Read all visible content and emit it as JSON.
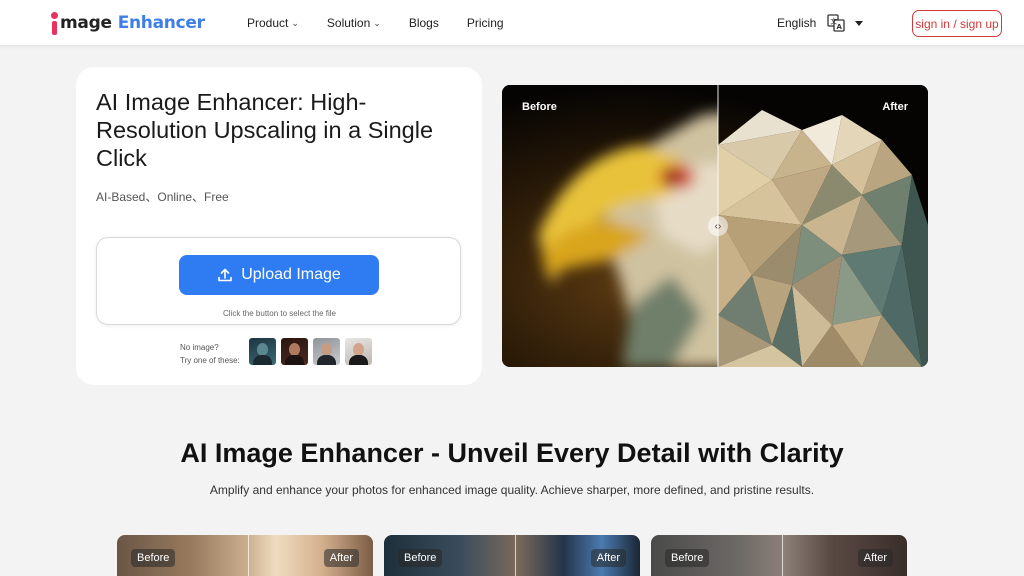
{
  "header": {
    "logo_word": "mage",
    "logo_brand": "Enhancer",
    "nav": [
      {
        "label": "Product",
        "has_dropdown": true
      },
      {
        "label": "Solution",
        "has_dropdown": true
      },
      {
        "label": "Blogs",
        "has_dropdown": false
      },
      {
        "label": "Pricing",
        "has_dropdown": false
      }
    ],
    "language": "English",
    "signin_label": "sign in / sign up"
  },
  "hero": {
    "title": "AI Image Enhancer: High-Resolution Upscaling in a Single Click",
    "subtitle": "AI-Based、Online、Free",
    "upload_label": "Upload Image",
    "upload_hint": "Click the button to select the file",
    "samples_line1": "No image?",
    "samples_line2": "Try one of these:"
  },
  "showcase": {
    "before_label": "Before",
    "after_label": "After"
  },
  "section": {
    "title": "AI Image Enhancer - Unveil Every Detail with Clarity",
    "subtitle": "Amplify and enhance your photos for enhanced image quality. Achieve sharper, more defined, and pristine results."
  },
  "examples": [
    {
      "before": "Before",
      "after": "After"
    },
    {
      "before": "Before",
      "after": "After"
    },
    {
      "before": "Before",
      "after": "After"
    }
  ],
  "colors": {
    "accent_blue": "#2f7bf1",
    "brand_pink": "#e8335f",
    "signin_red": "#d23b3b",
    "page_bg": "#f3f3f3"
  }
}
